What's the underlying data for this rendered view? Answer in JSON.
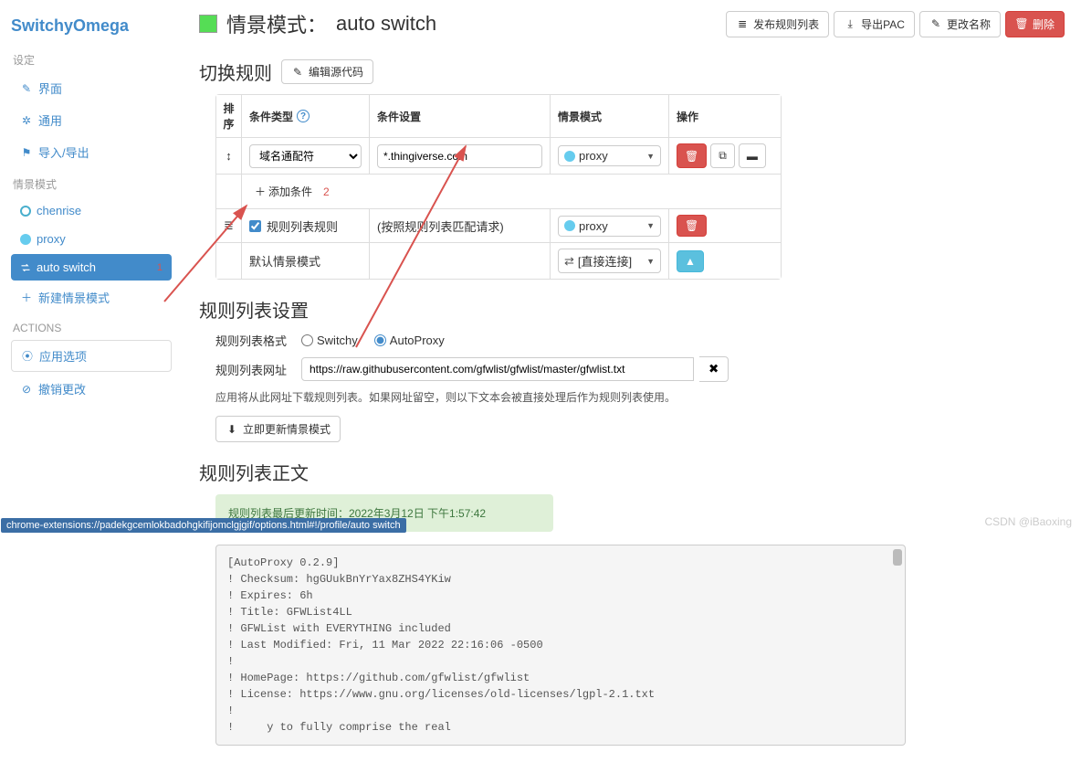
{
  "brand": "SwitchyOmega",
  "sidebar": {
    "groups": [
      {
        "header": "设定",
        "items": [
          {
            "label": "界面",
            "icon": "globe"
          },
          {
            "label": "通用",
            "icon": "gear"
          },
          {
            "label": "导入/导出",
            "icon": "flag"
          }
        ]
      },
      {
        "header": "情景模式",
        "items": [
          {
            "label": "chenrise",
            "icon": "profile-ring"
          },
          {
            "label": "proxy",
            "icon": "profile-fill"
          },
          {
            "label": "auto switch",
            "icon": "switch",
            "active": true,
            "badge": "1"
          },
          {
            "label": "新建情景模式",
            "icon": "plus"
          }
        ]
      },
      {
        "header": "ACTIONS",
        "items": [
          {
            "label": "应用选项",
            "icon": "ok",
            "boxed": true
          },
          {
            "label": "撤销更改",
            "icon": "ban"
          }
        ]
      }
    ]
  },
  "page": {
    "title_prefix": "情景模式：",
    "profile_name": "auto switch",
    "actions": {
      "publish": "发布规则列表",
      "export_pac": "导出PAC",
      "rename": "更改名称",
      "delete": "删除"
    }
  },
  "rules": {
    "heading": "切换规则",
    "edit_source": "编辑源代码",
    "columns": {
      "sort": "排序",
      "type": "条件类型",
      "cond": "条件设置",
      "profile": "情景模式",
      "act": "操作"
    },
    "type_options": [
      "域名通配符"
    ],
    "rows": [
      {
        "type": "域名通配符",
        "cond": "*.thingiverse.com",
        "profile": "proxy",
        "profile_icon": "blue",
        "actions": [
          "trash",
          "copy",
          "note"
        ]
      }
    ],
    "add_label": "添加条件",
    "add_badge": "2",
    "rulelist_row": {
      "checked": true,
      "label": "规则列表规则",
      "cond_text": "(按照规则列表匹配请求)",
      "profile": "proxy"
    },
    "default_row": {
      "label": "默认情景模式",
      "profile": "[直接连接]"
    }
  },
  "rulelist": {
    "heading": "规则列表设置",
    "format_label": "规则列表格式",
    "formats": [
      "Switchy",
      "AutoProxy"
    ],
    "format_selected": "AutoProxy",
    "url_label": "规则列表网址",
    "url_value": "https://raw.githubusercontent.com/gfwlist/gfwlist/master/gfwlist.txt",
    "hint": "应用将从此网址下载规则列表。如果网址留空，则以下文本会被直接处理后作为规则列表使用。",
    "update_btn": "立即更新情景模式"
  },
  "rulebody": {
    "heading": "规则列表正文",
    "alert": "规则列表最后更新时间：2022年3月12日 下午1:57:42",
    "code": "[AutoProxy 0.2.9]\n! Checksum: hgGUukBnYrYax8ZHS4YKiw\n! Expires: 6h\n! Title: GFWList4LL\n! GFWList with EVERYTHING included\n! Last Modified: Fri, 11 Mar 2022 22:16:06 -0500\n!\n! HomePage: https://github.com/gfwlist/gfwlist\n! License: https://www.gnu.org/licenses/old-licenses/lgpl-2.1.txt\n!\n!     y to fully comprise the real"
  },
  "statusbar": "chrome-extensions://padekgcemlokbadohgkifijomclgjgif/options.html#!/profile/auto switch",
  "watermark": "CSDN @iBaoxing"
}
